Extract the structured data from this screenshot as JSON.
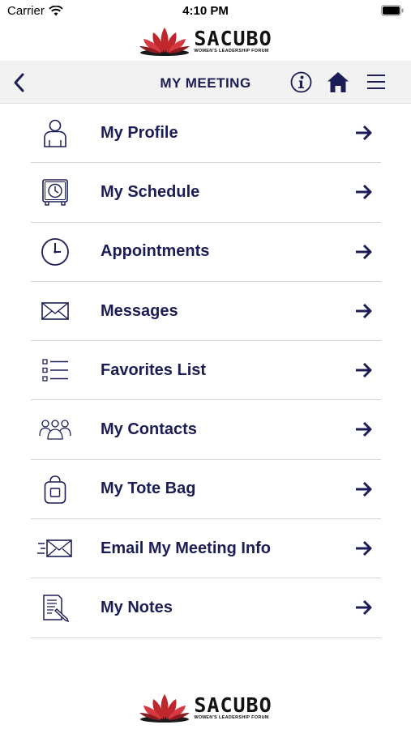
{
  "status_bar": {
    "carrier": "Carrier",
    "time": "4:10 PM"
  },
  "logo": {
    "word": "SACUBO",
    "tagline": "WOMEN'S LEADERSHIP FORUM"
  },
  "nav": {
    "title": "MY MEETING"
  },
  "colors": {
    "navy": "#1b1d57",
    "logo_red": "#c0272d",
    "nav_bg": "#f2f2f2",
    "divider": "#d4d4d4"
  },
  "menu": {
    "items": [
      {
        "label": "My Profile",
        "icon": "person-icon"
      },
      {
        "label": "My Schedule",
        "icon": "clock-schedule-icon"
      },
      {
        "label": "Appointments",
        "icon": "clock-icon"
      },
      {
        "label": "Messages",
        "icon": "envelope-icon"
      },
      {
        "label": "Favorites List",
        "icon": "checklist-icon"
      },
      {
        "label": "My Contacts",
        "icon": "group-icon"
      },
      {
        "label": "My Tote Bag",
        "icon": "tote-bag-icon"
      },
      {
        "label": "Email My Meeting Info",
        "icon": "email-send-icon"
      },
      {
        "label": "My Notes",
        "icon": "notes-icon"
      }
    ]
  }
}
